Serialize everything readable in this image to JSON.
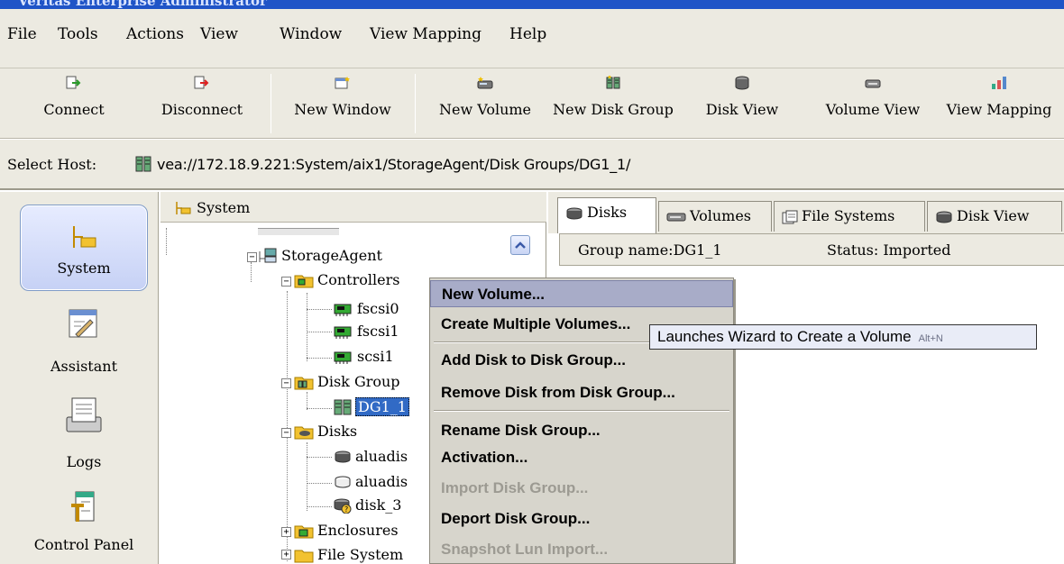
{
  "window": {
    "title": "Veritas Enterprise Administrator"
  },
  "menu": [
    "File",
    "Tools",
    "Actions",
    "View",
    "Window",
    "View Mapping",
    "Help"
  ],
  "toolbar": [
    {
      "label": "Connect",
      "icon": "connect-icon"
    },
    {
      "label": "Disconnect",
      "icon": "disconnect-icon"
    },
    {
      "label": "New Window",
      "icon": "new-window-icon"
    },
    {
      "label": "New Volume",
      "icon": "new-volume-icon"
    },
    {
      "label": "New Disk Group",
      "icon": "new-disk-group-icon"
    },
    {
      "label": "Disk View",
      "icon": "disk-view-icon"
    },
    {
      "label": "Volume View",
      "icon": "volume-view-icon"
    },
    {
      "label": "View Mapping",
      "icon": "view-mapping-icon"
    }
  ],
  "host": {
    "label": "Select Host:",
    "path": "vea://172.18.9.221:System/aix1/StorageAgent/Disk Groups/DG1_1/"
  },
  "nav": [
    {
      "label": "System",
      "icon": "system-icon",
      "active": true
    },
    {
      "label": "Assistant",
      "icon": "assistant-icon"
    },
    {
      "label": "Logs",
      "icon": "logs-icon"
    },
    {
      "label": "Control Panel",
      "icon": "control-panel-icon"
    }
  ],
  "tree": {
    "header": "System",
    "nodes": {
      "storage_agent": "StorageAgent",
      "controllers": "Controllers",
      "fscsi0": "fscsi0",
      "fscsi1": "fscsi1",
      "scsi1": "scsi1",
      "disk_groups": "Disk Group",
      "dg1": "DG1_1",
      "disks": "Disks",
      "disk_a": "aluadis",
      "disk_b": "aluadis",
      "disk_3": "disk_3",
      "enclosures": "Enclosures",
      "file_systems": "File System"
    }
  },
  "tabs": [
    {
      "label": "Disks",
      "active": true
    },
    {
      "label": "Volumes"
    },
    {
      "label": "File Systems"
    },
    {
      "label": "Disk View"
    }
  ],
  "group_info": {
    "name": "Group name:DG1_1",
    "status": "Status: Imported"
  },
  "context_menu": {
    "items": [
      {
        "label": "New Volume...",
        "state": "highlighted"
      },
      {
        "label": "Create Multiple Volumes..."
      },
      {
        "label": "Add Disk to Disk Group..."
      },
      {
        "label": "Remove Disk from Disk Group..."
      },
      {
        "label": "Rename Disk Group..."
      },
      {
        "label": "Activation..."
      },
      {
        "label": "Import Disk Group...",
        "state": "disabled"
      },
      {
        "label": "Deport Disk Group..."
      },
      {
        "label": "Snapshot Lun Import...",
        "state": "disabled"
      }
    ]
  },
  "tooltip": {
    "text": "Launches Wizard to Create a Volume",
    "accelerator": "Alt+N"
  },
  "colors": {
    "menu_bg": "#eceae1",
    "selection": "#316ac5",
    "highlight": "#a8acc8",
    "tooltip_bg": "#e9ecf7"
  }
}
